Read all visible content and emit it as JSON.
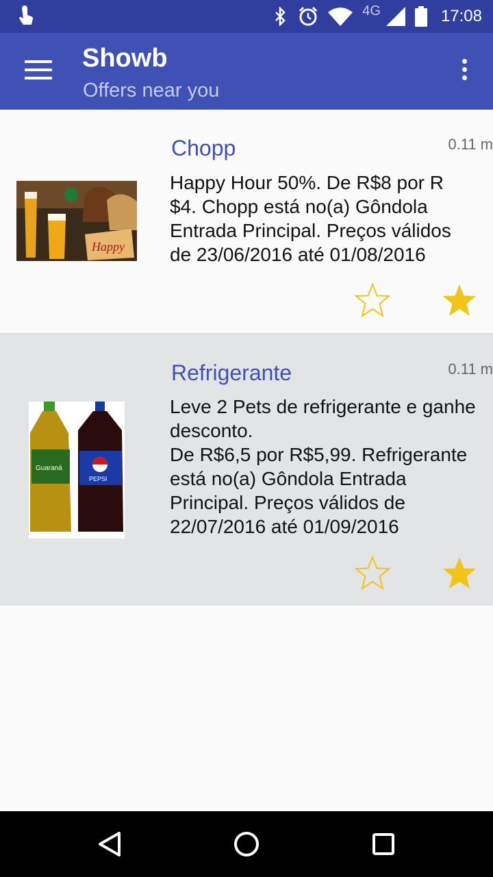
{
  "status_bar": {
    "time": "17:08",
    "network": "4G",
    "icons": [
      "touch-icon",
      "bluetooth-icon",
      "alarm-icon",
      "wifi-icon",
      "signal-icon",
      "battery-icon"
    ]
  },
  "app_bar": {
    "title": "Showb",
    "subtitle": "Offers near you",
    "color": "#3f51b5"
  },
  "offers": [
    {
      "title": "Chopp",
      "distance": "0.11 m",
      "description": "Happy Hour 50%. De R$8 por R\n$4. Chopp está no(a) Gôndola\nEntrada Principal. Preços válidos\nde 23/06/2016 até 01/08/2016",
      "image": "happy-hour-beer-image"
    },
    {
      "title": "Refrigerante",
      "distance": "0.11 m",
      "description": "Leve 2 Pets de refrigerante e ganhe\ndesconto.\nDe R$6,5 por R$5,99. Refrigerante\nestá no(a) Gôndola Entrada\nPrincipal. Preços válidos de\n22/07/2016 até 01/09/2016",
      "image": "soda-bottles-image"
    }
  ],
  "colors": {
    "accent": "#3f51b5",
    "status_bar": "#303f9f",
    "star": "#f0c419"
  }
}
